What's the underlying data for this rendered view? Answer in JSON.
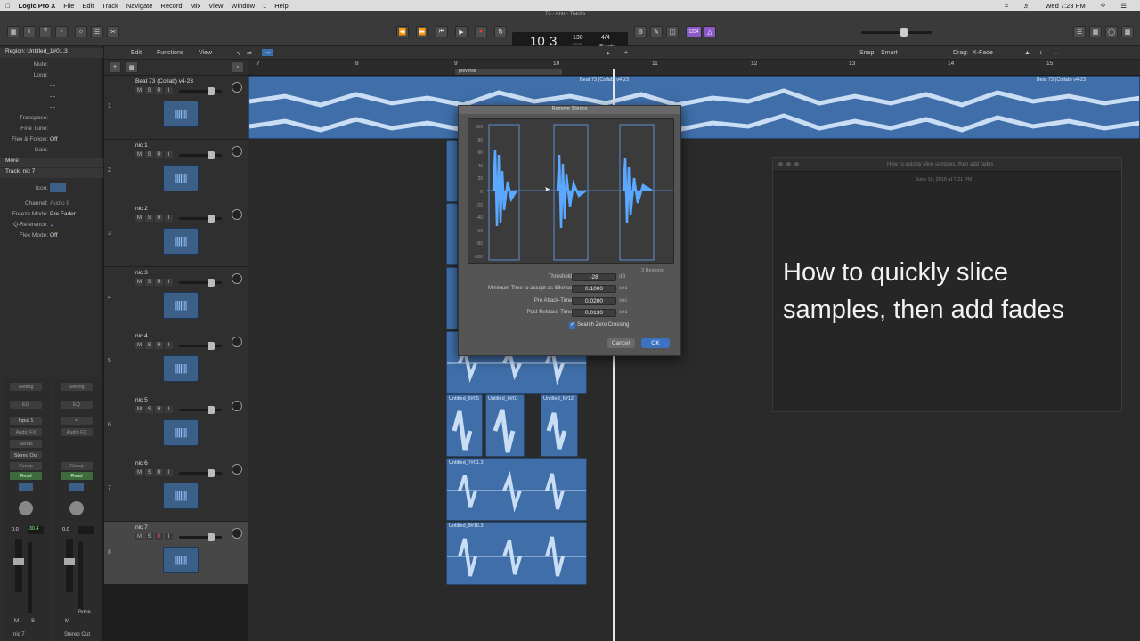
{
  "menubar": {
    "app": "Logic Pro X",
    "items": [
      "File",
      "Edit",
      "Track",
      "Navigate",
      "Record",
      "Mix",
      "View",
      "Window",
      "1",
      "Help"
    ],
    "clock": "Wed 7:23 PM"
  },
  "window": {
    "title": "73 - Ano - Tracks"
  },
  "lcd": {
    "bar": "10",
    "beat": "3",
    "bar_lbl": "BAR",
    "beat_lbl": "BEAT",
    "tempo": "130",
    "tempo_lbl": "KEEP",
    "tempo_sub": "TEMPO",
    "sig": "4/4",
    "key": "E♭min"
  },
  "toolbar": {
    "count_in": "1234"
  },
  "arrange_menu": {
    "edit": "Edit",
    "functions": "Functions",
    "view": "View",
    "snap_label": "Snap:",
    "snap_value": "Smart",
    "drag_label": "Drag:",
    "drag_value": "X-Fade"
  },
  "ruler": {
    "marks": [
      "7",
      "8",
      "9",
      "10",
      "11",
      "12",
      "13",
      "14",
      "15"
    ],
    "marker": "preverse"
  },
  "inspector": {
    "region_head": "Region: Untitled_1#01.3",
    "region_rows": [
      {
        "label": "Mute:",
        "value": ""
      },
      {
        "label": "Loop:",
        "value": ""
      },
      {
        "label": "",
        "value": "- -"
      },
      {
        "label": "",
        "value": "- -"
      },
      {
        "label": "",
        "value": "- -"
      },
      {
        "label": "Transpose:",
        "value": ""
      },
      {
        "label": "Fine Tune:",
        "value": ""
      },
      {
        "label": "Flex & Follow:",
        "value": "Off"
      },
      {
        "label": "Gain:",
        "value": ""
      }
    ],
    "more": "More",
    "track_head": "Track: nic 7",
    "track_rows": [
      {
        "label": "Icon:",
        "value": ""
      },
      {
        "label": "Channel:",
        "value": "Audio 8"
      },
      {
        "label": "Freeze Mode:",
        "value": "Pre Fader"
      },
      {
        "label": "Q-Reference:",
        "value": "✓"
      },
      {
        "label": "Flex Mode:",
        "value": "Off"
      }
    ]
  },
  "channel_strips": [
    {
      "setting": "Setting",
      "eq": "EQ",
      "input": "Input 1",
      "fx": "Audio FX",
      "sends": "Sends",
      "output": "Stereo Out",
      "group": "Group",
      "auto": "Read",
      "vol": "0.0",
      "peak": "-30.4",
      "mute": "M",
      "solo": "S",
      "name": "nic 7"
    },
    {
      "setting": "Setting",
      "eq": "EQ",
      "input": "",
      "fx": "Audio FX",
      "sends": "",
      "output": "",
      "group": "Group",
      "auto": "Read",
      "vol": "0.0",
      "peak": "",
      "mute": "M",
      "solo": "",
      "name": "Stereo Out",
      "bounce": "Bnce"
    }
  ],
  "tracks": [
    {
      "num": "1",
      "name": "Beat 73 (Collab) v4-23"
    },
    {
      "num": "2",
      "name": "nic 1"
    },
    {
      "num": "3",
      "name": "nic 2"
    },
    {
      "num": "4",
      "name": "nic 3"
    },
    {
      "num": "5",
      "name": "nic 4"
    },
    {
      "num": "6",
      "name": "nic 5"
    },
    {
      "num": "7",
      "name": "nic 6"
    },
    {
      "num": "8",
      "name": "nic 7"
    }
  ],
  "track_buttons": {
    "m": "M",
    "s": "S",
    "r": "R",
    "i": "I"
  },
  "regions": {
    "beat_a": "Beat 73 (Collab) v4-23",
    "beat_b": "Beat 73 (Collab) v4-23",
    "r1": "Untitled_6#05",
    "r2": "Untitled_6#01",
    "r3": "Untitled_6#12",
    "r4": "Untitled_7#01.3",
    "r5": "Untitled_8#16.3"
  },
  "dialog": {
    "title": "Remove Silence",
    "y_ticks": [
      "100",
      "80",
      "60",
      "40",
      "20",
      "0",
      "-20",
      "-40",
      "-60",
      "-80",
      "-100"
    ],
    "regions_count": "3 Regions",
    "threshold_label": "Threshold:",
    "threshold": "-28",
    "threshold_unit": "dB",
    "min_time_label": "Minimum Time to accept as Silence:",
    "min_time": "0.1000",
    "min_time_unit": "sec",
    "pre_attack_label": "Pre Attack-Time:",
    "pre_attack": "0.0200",
    "pre_attack_unit": "sec",
    "post_release_label": "Post Release-Time:",
    "post_release": "0.0130",
    "post_release_unit": "sec",
    "zero_crossing": "Search Zero Crossing",
    "cancel": "Cancel",
    "ok": "OK"
  },
  "video": {
    "title": "How to quickly slice samples, then add fades",
    "date": "June 19, 2019 at 7:21 PM",
    "heading_line1": "How to quickly slice",
    "heading_line2": "samples, then add fades"
  }
}
